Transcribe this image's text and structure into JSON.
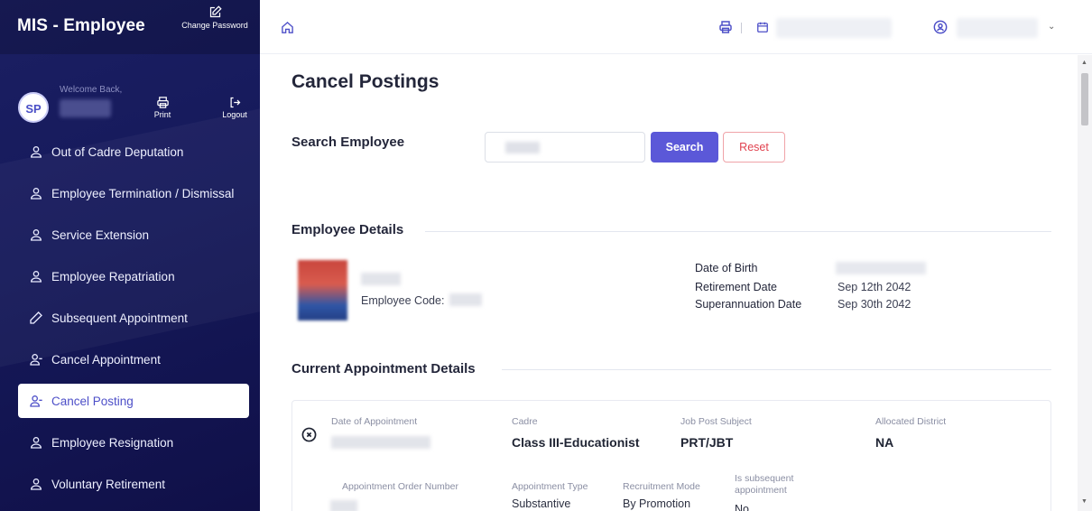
{
  "app": {
    "title": "MIS - Employee",
    "change_password_label": "Change Password"
  },
  "user": {
    "initials": "SP",
    "welcome_text": "Welcome Back,",
    "print_label": "Print",
    "logout_label": "Logout"
  },
  "sidebar": {
    "items": [
      {
        "label": "Out of Cadre Deputation",
        "icon": "user-icon",
        "active": false
      },
      {
        "label": "Employee Termination / Dismissal",
        "icon": "user-icon",
        "active": false
      },
      {
        "label": "Service Extension",
        "icon": "user-icon",
        "active": false
      },
      {
        "label": "Employee Repatriation",
        "icon": "user-icon",
        "active": false
      },
      {
        "label": "Subsequent Appointment",
        "icon": "pencil-icon",
        "active": false
      },
      {
        "label": "Cancel Appointment",
        "icon": "user-minus-icon",
        "active": false
      },
      {
        "label": "Cancel Posting",
        "icon": "user-minus-icon",
        "active": true
      },
      {
        "label": "Employee Resignation",
        "icon": "user-icon",
        "active": false
      },
      {
        "label": "Voluntary Retirement",
        "icon": "user-icon",
        "active": false
      }
    ]
  },
  "page": {
    "title": "Cancel Postings",
    "search_label": "Search Employee",
    "search_button": "Search",
    "reset_button": "Reset"
  },
  "employee_details": {
    "section_title": "Employee Details",
    "employee_code_label": "Employee Code:",
    "dob_label": "Date of Birth",
    "retirement_label": "Retirement Date",
    "retirement_value": "Sep 12th 2042",
    "superannuation_label": "Superannuation Date",
    "superannuation_value": "Sep 30th 2042"
  },
  "appointment": {
    "section_title": "Current Appointment Details",
    "date_of_appointment_label": "Date of Appointment",
    "cadre_label": "Cadre",
    "cadre_value": "Class III-Educationist",
    "job_post_subject_label": "Job Post Subject",
    "job_post_subject_value": "PRT/JBT",
    "allocated_district_label": "Allocated District",
    "allocated_district_value": "NA",
    "order_number_label": "Appointment Order Number",
    "appointment_type_label": "Appointment Type",
    "appointment_type_value": "Substantive",
    "recruitment_mode_label": "Recruitment Mode",
    "recruitment_mode_value": "By Promotion",
    "is_subsequent_label": "Is subsequent appointment",
    "is_subsequent_value": "No"
  },
  "colors": {
    "sidebar_bg": "#15195a",
    "accent": "#5b58d8",
    "reset": "#e1424f"
  }
}
